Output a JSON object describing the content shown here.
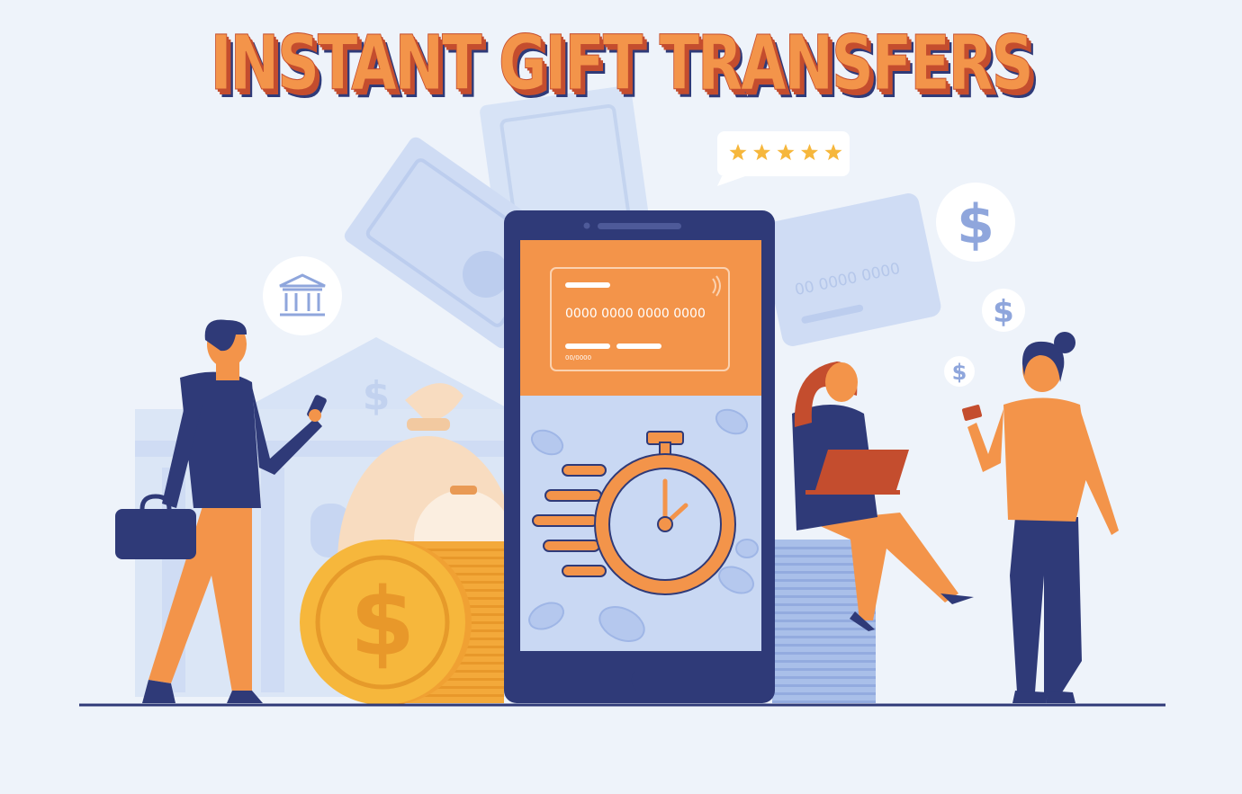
{
  "headline": "INSTANT GIFT TRANSFERS",
  "rating_stars": 5,
  "card_front": {
    "number": "0000 0000 0000 0000",
    "expiry": "00/0000"
  },
  "card_back": {
    "number": "00 0000 0000"
  },
  "colors": {
    "background": "#eef3fa",
    "orange": "#f3944a",
    "navy": "#2f3a78",
    "light_blue": "#c7d6f2",
    "gold": "#f6b73c",
    "title_shadow": "#c44d2e"
  }
}
